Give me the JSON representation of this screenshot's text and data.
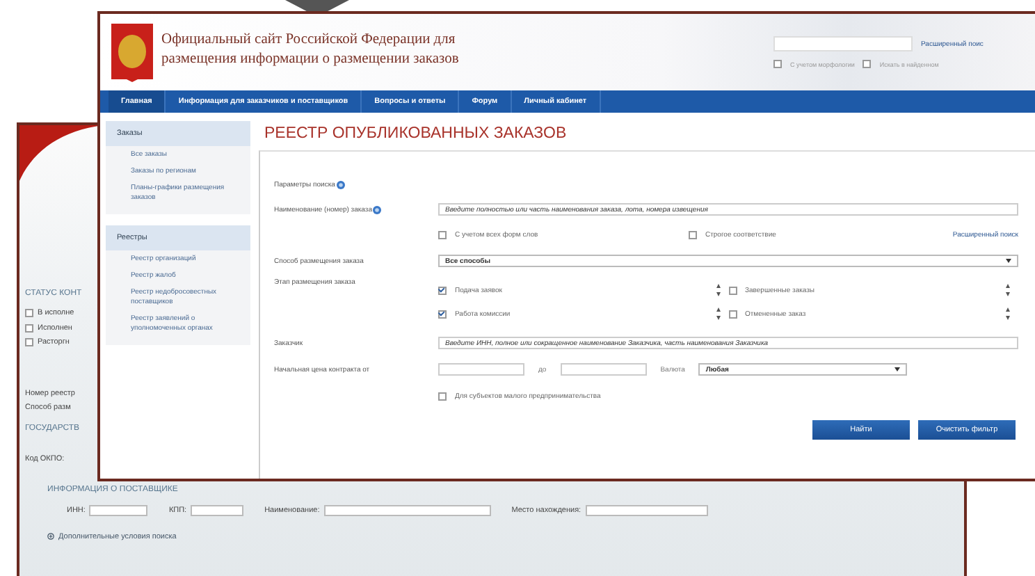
{
  "back_window": {
    "status_heading": "СТАТУС КОНТ",
    "status_options": [
      {
        "label": "В исполне",
        "checked": false
      },
      {
        "label": "Исполнен",
        "checked": false
      },
      {
        "label": "Расторгн",
        "checked": false
      }
    ],
    "fields": [
      "Номер реестр",
      "Способ разм"
    ],
    "state_heading": "ГОСУДАРСТВ",
    "okpo_label": "Код ОКПО:",
    "supplier_heading": "ИНФОРМАЦИЯ О ПОСТАВЩИКЕ",
    "supplier_fields": [
      {
        "label": "ИНН:"
      },
      {
        "label": "КПП:"
      },
      {
        "label": "Наименование:"
      },
      {
        "label": "Место нахождения:"
      }
    ],
    "more_conditions": "Дополнительные условия поиска"
  },
  "front_window": {
    "site_title": [
      "Официальный сайт Российской Федерации для",
      "размещения информации о размещении заказов"
    ],
    "header_search": {
      "link": "Расширенный поис",
      "options": [
        {
          "label": "С учетом морфологии",
          "checked": false
        },
        {
          "label": "Искать в найденном",
          "checked": false
        }
      ]
    },
    "nav": [
      {
        "label": "Главная",
        "selected": true
      },
      {
        "label": "Информация для заказчиков и поставщиков",
        "selected": false
      },
      {
        "label": "Вопросы и ответы",
        "selected": false
      },
      {
        "label": "Форум",
        "selected": false
      },
      {
        "label": "Личный кабинет",
        "selected": false
      }
    ],
    "sidebar": [
      {
        "title": "Заказы",
        "items": [
          "Все заказы",
          "Заказы по регионам",
          "Планы-графики размещения заказов"
        ]
      },
      {
        "title": "Реестры",
        "items": [
          "Реестр организаций",
          "Реестр жалоб",
          "Реестр недобросовестных поставщиков",
          "Реестр заявлений о уполномоченных органах"
        ]
      }
    ],
    "page_title": "РЕЕСТР ОПУБЛИКОВАННЫХ ЗАКАЗОВ",
    "form": {
      "params_label": "Параметры поиска",
      "name_label": "Наименование (номер) заказа",
      "name_placeholder": "Введите полностью или часть наименования заказа, лота, номера извещения",
      "name_options": [
        {
          "label": "С учетом всех форм слов",
          "checked": false
        },
        {
          "label": "Строгое соответствие",
          "checked": false
        }
      ],
      "advanced_link": "Расширенный поиск",
      "method_label": "Способ размещения заказа",
      "method_value": "Все способы",
      "stage_label": "Этап размещения заказа",
      "stages": [
        {
          "label": "Подача заявок",
          "checked": true
        },
        {
          "label": "Завершенные заказы",
          "checked": false
        },
        {
          "label": "Работа комиссии",
          "checked": true
        },
        {
          "label": "Отмененные заказ",
          "checked": false
        }
      ],
      "customer_label": "Заказчик",
      "customer_placeholder": "Введите ИНН, полное или сокращенное наименование Заказчика, часть наименования Заказчика",
      "price_label": "Начальная цена контракта от",
      "price_to_label": "до",
      "currency_label": "Валюта",
      "currency_value": "Любая",
      "small_business": {
        "label": "Для субъектов малого предпринимательства",
        "checked": false
      },
      "buttons": [
        "Найти",
        "Очистить фильтр"
      ]
    }
  }
}
